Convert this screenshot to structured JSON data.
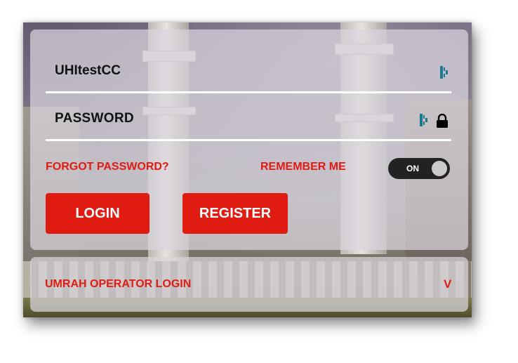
{
  "login_form": {
    "username_value": "UHItestCC",
    "password_placeholder": "PASSWORD",
    "forgot_password_label": "FORGOT PASSWORD?",
    "remember_me_label": "REMEMBER ME",
    "remember_toggle_state": "ON",
    "login_button_label": "LOGIN",
    "register_button_label": "REGISTER"
  },
  "operator_section": {
    "label": "UMRAH OPERATOR LOGIN",
    "chevron": "V"
  },
  "icons": {
    "field_extension": "password-manager-icon",
    "password_lock": "lock-icon"
  },
  "colors": {
    "accent": "#e01b12",
    "toggle_bg": "#222222",
    "panel_bg": "rgba(218,214,222,0.72)",
    "extension_icon": "#1a7a8c"
  }
}
